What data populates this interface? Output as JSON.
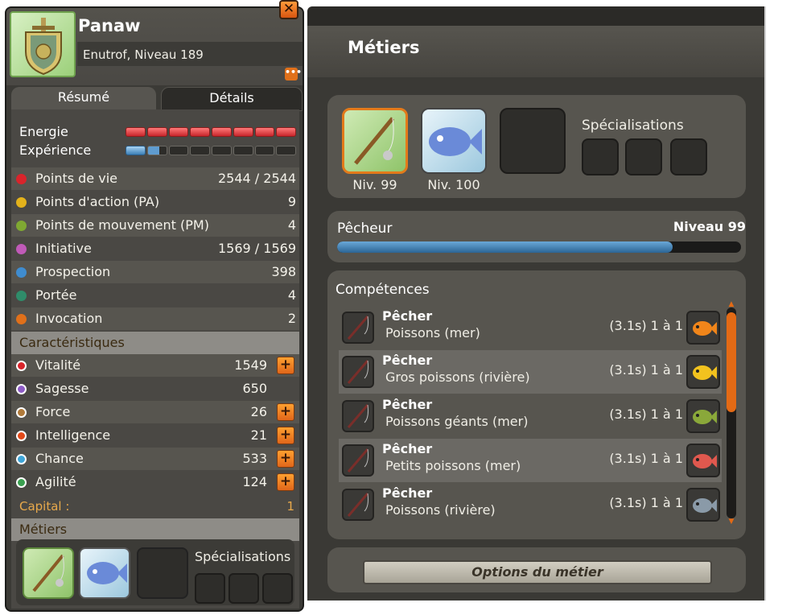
{
  "character": {
    "name": "Panaw",
    "class_level": "Enutrof, Niveau 189",
    "tabs": [
      "Résumé",
      "Détails"
    ],
    "energy_label": "Energie",
    "energy_fraction": 1.0,
    "experience_label": "Expérience",
    "experience_fraction": 0.2,
    "stats": [
      {
        "label": "Points de vie",
        "value": "2544 / 2544",
        "icon": "heart-icon",
        "color": "#d9242b"
      },
      {
        "label": "Points d'action (PA)",
        "value": "9",
        "icon": "star-icon",
        "color": "#e3b21b"
      },
      {
        "label": "Points de mouvement (PM)",
        "value": "4",
        "icon": "boot-icon",
        "color": "#7fa832"
      },
      {
        "label": "Initiative",
        "value": "1569 / 1569",
        "icon": "initiative-icon",
        "color": "#c05ab8"
      },
      {
        "label": "Prospection",
        "value": "398",
        "icon": "prospection-icon",
        "color": "#3f8ccf"
      },
      {
        "label": "Portée",
        "value": "4",
        "icon": "range-icon",
        "color": "#2f8c6a"
      },
      {
        "label": "Invocation",
        "value": "2",
        "icon": "invocation-icon",
        "color": "#e0701a"
      }
    ],
    "characteristics_title": "Caractéristiques",
    "characteristics": [
      {
        "label": "Vitalité",
        "value": "1549",
        "icon": "vitality-icon",
        "color": "#d9242b",
        "plus": true
      },
      {
        "label": "Sagesse",
        "value": "650",
        "icon": "wisdom-icon",
        "color": "#8e5cc7",
        "plus": false
      },
      {
        "label": "Force",
        "value": "26",
        "icon": "strength-icon",
        "color": "#b07a3a",
        "plus": true
      },
      {
        "label": "Intelligence",
        "value": "21",
        "icon": "intelligence-icon",
        "color": "#e34a1a",
        "plus": true
      },
      {
        "label": "Chance",
        "value": "533",
        "icon": "chance-icon",
        "color": "#3fa6d8",
        "plus": true
      },
      {
        "label": "Agilité",
        "value": "124",
        "icon": "agility-icon",
        "color": "#3aa050",
        "plus": true
      }
    ],
    "capital_label": "Capital :",
    "capital_value": "1",
    "jobs_title": "Métiers",
    "specialisations_label": "Spécialisations"
  },
  "jobs_window": {
    "title": "Métiers",
    "slots": [
      {
        "icon": "fishing-rod-icon",
        "level": "Niv. 99"
      },
      {
        "icon": "fish-icon",
        "level": "Niv. 100"
      }
    ],
    "specialisations_label": "Spécialisations",
    "current_job": "Pêcheur",
    "current_level": "Niveau 99",
    "xp_fraction": 0.83,
    "skills_title": "Compétences",
    "skills": [
      {
        "name": "Pêcher",
        "resource": "Poissons (mer)",
        "time": "(3.1s) 1 à 1",
        "item_icon": "orange-shrimp-icon",
        "item_color": "#f0851a"
      },
      {
        "name": "Pêcher",
        "resource": "Gros poissons (rivière)",
        "time": "(3.1s) 1 à 1",
        "item_icon": "yellow-fish-icon",
        "item_color": "#f2c21e"
      },
      {
        "name": "Pêcher",
        "resource": "Poissons géants (mer)",
        "time": "(3.1s) 1 à 1",
        "item_icon": "green-fish-icon",
        "item_color": "#8aa83a"
      },
      {
        "name": "Pêcher",
        "resource": "Petits poissons (mer)",
        "time": "(3.1s) 1 à 1",
        "item_icon": "red-fish-icon",
        "item_color": "#e0584e"
      },
      {
        "name": "Pêcher",
        "resource": "Poissons (rivière)",
        "time": "(3.1s) 1 à 1",
        "item_icon": "grey-fish-icon",
        "item_color": "#8a9aa8"
      }
    ],
    "options_label": "Options du métier"
  }
}
